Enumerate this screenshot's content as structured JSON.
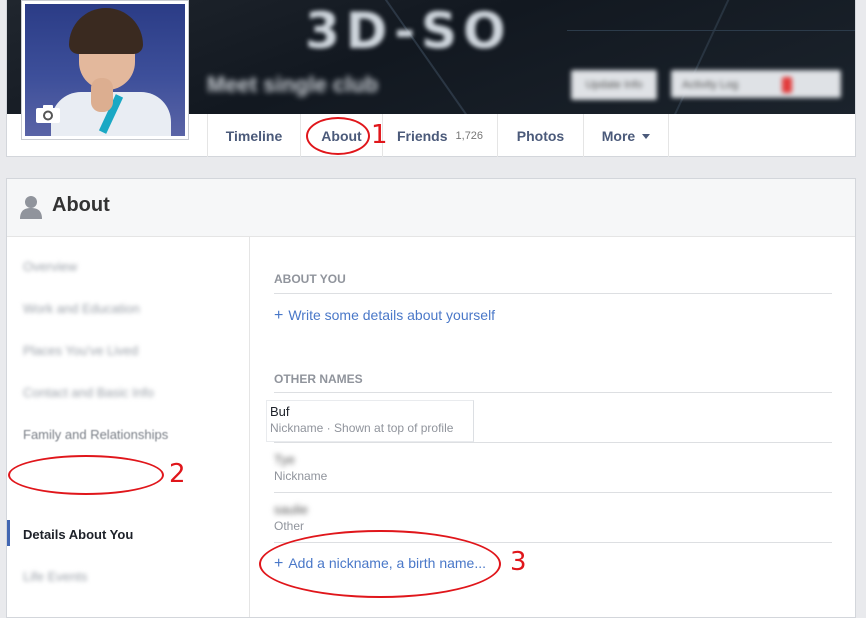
{
  "cover": {
    "logo": "3D-SO",
    "subtitle": "Meet single club",
    "btn1": "Update Info",
    "btn2": "Activity Log"
  },
  "tabs": [
    {
      "label": "Timeline"
    },
    {
      "label": "About"
    },
    {
      "label": "Friends",
      "count": "1,726"
    },
    {
      "label": "Photos"
    },
    {
      "label": "More"
    }
  ],
  "about": {
    "title": "About",
    "nav": [
      "Overview",
      "Work and Education",
      "Places You've Lived",
      "Contact and Basic Info",
      "Family and Relationships",
      "Details About You",
      "Life Events"
    ],
    "about_you": {
      "heading": "ABOUT YOU",
      "link": "Write some details about yourself"
    },
    "other_names": {
      "heading": "OTHER NAMES",
      "items": [
        {
          "name": "Buf",
          "type": "Nickname · Shown at top of profile"
        },
        {
          "name": "Tye",
          "type": "Nickname"
        },
        {
          "name": "saulie",
          "type": "Other"
        }
      ],
      "add_link": "Add a nickname, a birth name..."
    }
  },
  "annotations": {
    "n1": "1",
    "n2": "2",
    "n3": "3"
  },
  "colors": {
    "link": "#4a78c8",
    "annotation": "#e0161b"
  }
}
